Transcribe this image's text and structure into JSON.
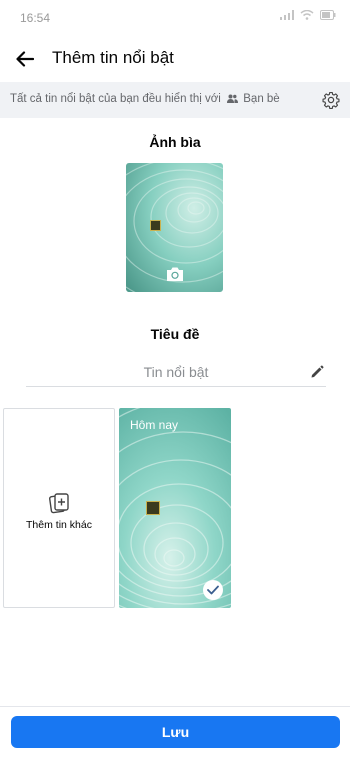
{
  "status_bar": {
    "time": "16:54"
  },
  "header": {
    "title": "Thêm tin nổi bật"
  },
  "info_bar": {
    "text_before": "Tất cả tin nổi bật của bạn đều hiển thị với",
    "audience": "Bạn bè"
  },
  "cover": {
    "label": "Ảnh bìa"
  },
  "title_section": {
    "label": "Tiêu đề",
    "placeholder": "Tin nổi bật"
  },
  "stories": {
    "add_more_label": "Thêm tin khác",
    "items": [
      {
        "label": "Hôm nay",
        "selected": true
      }
    ]
  },
  "save_button": {
    "label": "Lưu"
  },
  "colors": {
    "accent": "#1877f2",
    "story_teal": "#7fd3c4"
  }
}
